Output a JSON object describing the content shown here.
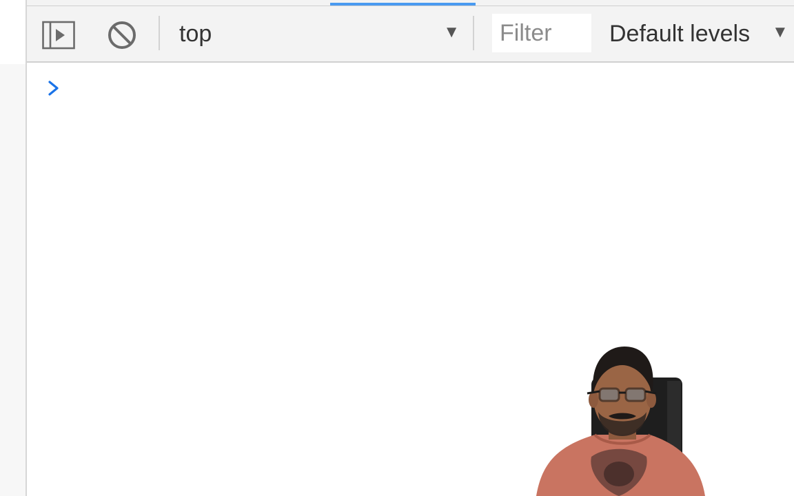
{
  "toolbar": {
    "sidebar_icon": "sidebar-toggle-icon",
    "clear_icon": "clear-console-icon",
    "context": {
      "label": "top",
      "arrow": "▼"
    },
    "filter": {
      "placeholder": "Filter",
      "value": ""
    },
    "levels": {
      "label": "Default levels",
      "arrow": "▼"
    }
  },
  "console": {
    "prompt_icon": "chevron-right-icon",
    "accent_color": "#1a73e8"
  },
  "colors": {
    "tab_indicator": "#4a9af0",
    "toolbar_bg": "#f3f3f3"
  }
}
